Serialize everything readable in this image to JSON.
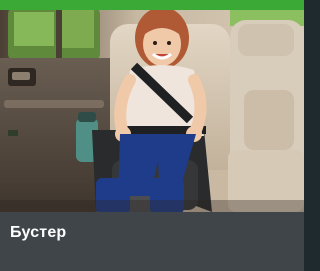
{
  "card": {
    "caption": "Бустер",
    "accent_color": "#3aa935",
    "caption_bg_color": "#3f4548"
  },
  "photo": {
    "subject": "child-on-booster-seat-in-car-icon"
  }
}
